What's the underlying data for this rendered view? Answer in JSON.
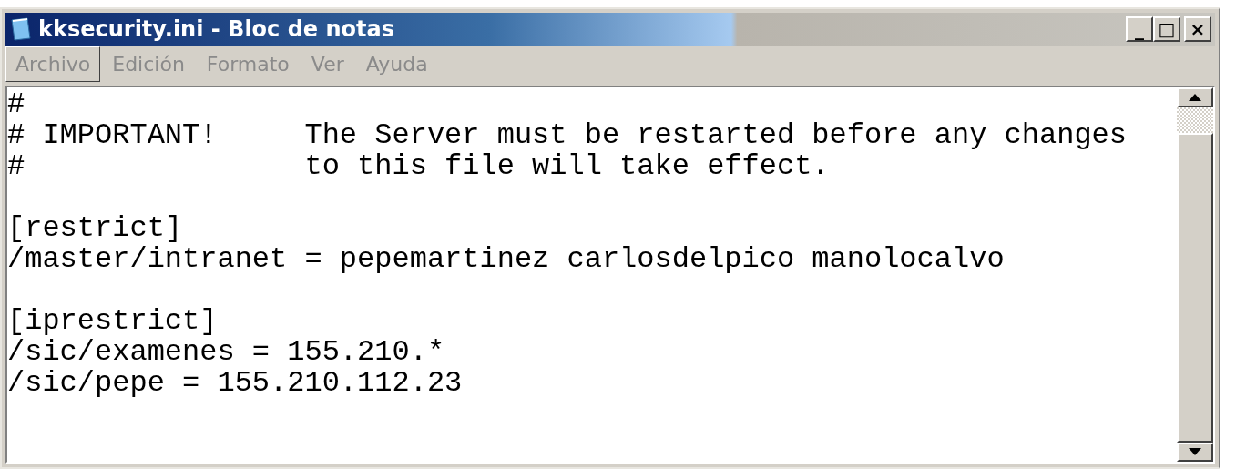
{
  "window": {
    "title": "kksecurity.ini - Bloc de notas",
    "controls": [
      "_",
      "□",
      "×"
    ]
  },
  "menu": [
    {
      "label": "Archivo",
      "selected": true
    },
    {
      "label": "Edición",
      "selected": false
    },
    {
      "label": "Formato",
      "selected": false
    },
    {
      "label": "Ver",
      "selected": false
    },
    {
      "label": "Ayuda",
      "selected": false
    }
  ],
  "editor": {
    "blocks": [
      [
        "#",
        "# IMPORTANT!     The Server must be restarted before any changes",
        "#                to this file will take effect."
      ],
      [
        "[restrict]",
        "/master/intranet = pepemartinez carlosdelpico manolocalvo"
      ],
      [
        "[iprestrict]",
        "/sic/examenes = 155.210.*",
        "/sic/pepe = 155.210.112.23"
      ]
    ]
  }
}
